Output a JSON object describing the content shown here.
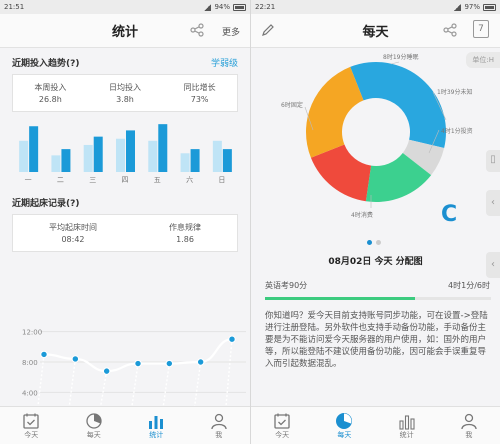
{
  "left": {
    "status": {
      "time": "21:51",
      "battery": "94%"
    },
    "title": "统计",
    "more": "更多",
    "invest": {
      "heading": "近期投入趋势(?)",
      "link": "学弱级",
      "stats": [
        {
          "label": "本周投入",
          "value": "26.8h"
        },
        {
          "label": "日均投入",
          "value": "3.8h"
        },
        {
          "label": "同比增长",
          "value": "73%"
        }
      ]
    },
    "weekdays": [
      "一",
      "二",
      "三",
      "四",
      "五",
      "六",
      "日"
    ],
    "sleep": {
      "heading": "近期起床记录(?)",
      "stats": [
        {
          "label": "平均起床时间",
          "value": "08:42"
        },
        {
          "label": "作息规律",
          "value": "1.86"
        }
      ],
      "yticks": [
        "12:00",
        "8:00",
        "4:00"
      ]
    },
    "tabs": [
      "今天",
      "每天",
      "统计",
      "我"
    ]
  },
  "right": {
    "status": {
      "time": "22:21",
      "battery": "97%"
    },
    "title": "每天",
    "calendar_day": "7",
    "unit_tag": "单位:H",
    "donut_labels": [
      "8时19分睡眠",
      "1时39分未知",
      "4时1分投资",
      "4时消费",
      "6时固定"
    ],
    "letter": "C",
    "caption": "08月02日 今天 分配图",
    "task": {
      "name": "英语考90分",
      "time": "4时1分/6时"
    },
    "tip": "你知道吗？爱今天目前支持账号同步功能，可在设置->登陆进行注册登陆。另外软件也支持手动备份功能，手动备份主要是为不能访问爱今天服务器的用户使用，如：国外的用户等，所以能登陆不建议使用备份功能，因可能会手误重复导入而引起数据混乱。",
    "tabs": [
      "今天",
      "每天",
      "统计",
      "我"
    ]
  },
  "chart_data": [
    {
      "type": "bar",
      "categories": [
        "一",
        "二",
        "三",
        "四",
        "五",
        "六",
        "日"
      ],
      "series": [
        {
          "values": [
            3.0,
            1.6,
            2.6,
            3.2,
            3.0,
            1.8,
            3.0
          ]
        },
        {
          "values": [
            4.4,
            2.2,
            3.4,
            4.0,
            4.6,
            2.2,
            2.2
          ]
        }
      ],
      "ylim": [
        0,
        5
      ]
    },
    {
      "type": "line",
      "x": [
        1,
        2,
        3,
        4,
        5,
        6,
        7
      ],
      "y": [
        9.0,
        8.4,
        6.8,
        7.8,
        7.8,
        8.0,
        11.0
      ],
      "yticks": [
        "12:00",
        "8:00",
        "4:00"
      ],
      "ylim": [
        3,
        13
      ]
    },
    {
      "type": "pie",
      "labels": [
        "8时19分睡眠",
        "1时39分未知",
        "4时1分投资",
        "4时消费",
        "6时固定"
      ],
      "values": [
        8.32,
        1.65,
        4.02,
        4.0,
        6.0
      ],
      "colors": [
        "#29a7df",
        "#d9d9d9",
        "#3cd08f",
        "#ef4a3c",
        "#f5a623"
      ]
    }
  ]
}
